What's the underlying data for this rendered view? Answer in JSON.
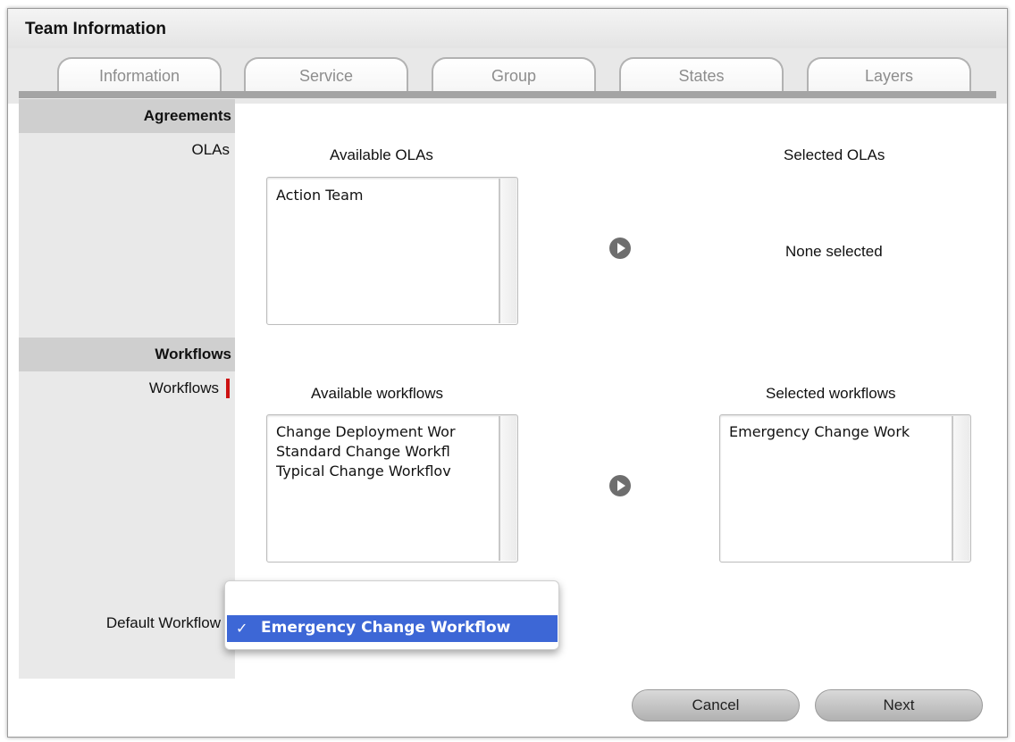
{
  "header": {
    "title": "Team Information"
  },
  "tabs": [
    {
      "label": "Information"
    },
    {
      "label": "Service"
    },
    {
      "label": "Group"
    },
    {
      "label": "States"
    },
    {
      "label": "Layers"
    }
  ],
  "sections": {
    "agreements": {
      "header": "Agreements",
      "field_label": "OLAs"
    },
    "workflows": {
      "header": "Workflows",
      "field_label": "Workflows",
      "default_label": "Default Workflow"
    }
  },
  "olas": {
    "available_title": "Available OLAs",
    "selected_title": "Selected OLAs",
    "available_items": [
      "Action Team"
    ],
    "selected_empty": "None selected"
  },
  "workflows": {
    "available_title": "Available workflows",
    "selected_title": "Selected workflows",
    "available_items": [
      "Change Deployment Wor",
      "Standard Change Workfl",
      "Typical Change Workflov"
    ],
    "selected_items": [
      "Emergency Change Work"
    ]
  },
  "default_workflow": {
    "selected_value": "Emergency Change Workflow",
    "check_mark": "✓"
  },
  "footer": {
    "cancel_label": "Cancel",
    "next_label": "Next"
  },
  "colors": {
    "selection_highlight": "#3d67d6",
    "required_marker": "#cc1111",
    "section_header_bg": "#cfcfcf"
  }
}
